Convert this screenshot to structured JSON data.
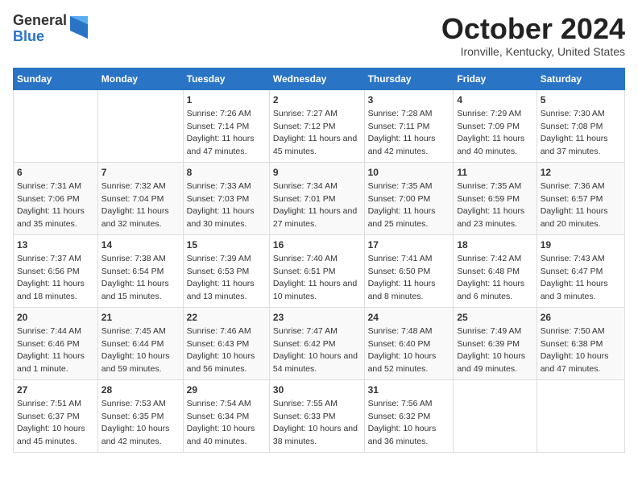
{
  "logo": {
    "general": "General",
    "blue": "Blue"
  },
  "header": {
    "month": "October 2024",
    "location": "Ironville, Kentucky, United States"
  },
  "weekdays": [
    "Sunday",
    "Monday",
    "Tuesday",
    "Wednesday",
    "Thursday",
    "Friday",
    "Saturday"
  ],
  "weeks": [
    [
      {
        "day": "",
        "info": ""
      },
      {
        "day": "",
        "info": ""
      },
      {
        "day": "1",
        "info": "Sunrise: 7:26 AM\nSunset: 7:14 PM\nDaylight: 11 hours and 47 minutes."
      },
      {
        "day": "2",
        "info": "Sunrise: 7:27 AM\nSunset: 7:12 PM\nDaylight: 11 hours and 45 minutes."
      },
      {
        "day": "3",
        "info": "Sunrise: 7:28 AM\nSunset: 7:11 PM\nDaylight: 11 hours and 42 minutes."
      },
      {
        "day": "4",
        "info": "Sunrise: 7:29 AM\nSunset: 7:09 PM\nDaylight: 11 hours and 40 minutes."
      },
      {
        "day": "5",
        "info": "Sunrise: 7:30 AM\nSunset: 7:08 PM\nDaylight: 11 hours and 37 minutes."
      }
    ],
    [
      {
        "day": "6",
        "info": "Sunrise: 7:31 AM\nSunset: 7:06 PM\nDaylight: 11 hours and 35 minutes."
      },
      {
        "day": "7",
        "info": "Sunrise: 7:32 AM\nSunset: 7:04 PM\nDaylight: 11 hours and 32 minutes."
      },
      {
        "day": "8",
        "info": "Sunrise: 7:33 AM\nSunset: 7:03 PM\nDaylight: 11 hours and 30 minutes."
      },
      {
        "day": "9",
        "info": "Sunrise: 7:34 AM\nSunset: 7:01 PM\nDaylight: 11 hours and 27 minutes."
      },
      {
        "day": "10",
        "info": "Sunrise: 7:35 AM\nSunset: 7:00 PM\nDaylight: 11 hours and 25 minutes."
      },
      {
        "day": "11",
        "info": "Sunrise: 7:35 AM\nSunset: 6:59 PM\nDaylight: 11 hours and 23 minutes."
      },
      {
        "day": "12",
        "info": "Sunrise: 7:36 AM\nSunset: 6:57 PM\nDaylight: 11 hours and 20 minutes."
      }
    ],
    [
      {
        "day": "13",
        "info": "Sunrise: 7:37 AM\nSunset: 6:56 PM\nDaylight: 11 hours and 18 minutes."
      },
      {
        "day": "14",
        "info": "Sunrise: 7:38 AM\nSunset: 6:54 PM\nDaylight: 11 hours and 15 minutes."
      },
      {
        "day": "15",
        "info": "Sunrise: 7:39 AM\nSunset: 6:53 PM\nDaylight: 11 hours and 13 minutes."
      },
      {
        "day": "16",
        "info": "Sunrise: 7:40 AM\nSunset: 6:51 PM\nDaylight: 11 hours and 10 minutes."
      },
      {
        "day": "17",
        "info": "Sunrise: 7:41 AM\nSunset: 6:50 PM\nDaylight: 11 hours and 8 minutes."
      },
      {
        "day": "18",
        "info": "Sunrise: 7:42 AM\nSunset: 6:48 PM\nDaylight: 11 hours and 6 minutes."
      },
      {
        "day": "19",
        "info": "Sunrise: 7:43 AM\nSunset: 6:47 PM\nDaylight: 11 hours and 3 minutes."
      }
    ],
    [
      {
        "day": "20",
        "info": "Sunrise: 7:44 AM\nSunset: 6:46 PM\nDaylight: 11 hours and 1 minute."
      },
      {
        "day": "21",
        "info": "Sunrise: 7:45 AM\nSunset: 6:44 PM\nDaylight: 10 hours and 59 minutes."
      },
      {
        "day": "22",
        "info": "Sunrise: 7:46 AM\nSunset: 6:43 PM\nDaylight: 10 hours and 56 minutes."
      },
      {
        "day": "23",
        "info": "Sunrise: 7:47 AM\nSunset: 6:42 PM\nDaylight: 10 hours and 54 minutes."
      },
      {
        "day": "24",
        "info": "Sunrise: 7:48 AM\nSunset: 6:40 PM\nDaylight: 10 hours and 52 minutes."
      },
      {
        "day": "25",
        "info": "Sunrise: 7:49 AM\nSunset: 6:39 PM\nDaylight: 10 hours and 49 minutes."
      },
      {
        "day": "26",
        "info": "Sunrise: 7:50 AM\nSunset: 6:38 PM\nDaylight: 10 hours and 47 minutes."
      }
    ],
    [
      {
        "day": "27",
        "info": "Sunrise: 7:51 AM\nSunset: 6:37 PM\nDaylight: 10 hours and 45 minutes."
      },
      {
        "day": "28",
        "info": "Sunrise: 7:53 AM\nSunset: 6:35 PM\nDaylight: 10 hours and 42 minutes."
      },
      {
        "day": "29",
        "info": "Sunrise: 7:54 AM\nSunset: 6:34 PM\nDaylight: 10 hours and 40 minutes."
      },
      {
        "day": "30",
        "info": "Sunrise: 7:55 AM\nSunset: 6:33 PM\nDaylight: 10 hours and 38 minutes."
      },
      {
        "day": "31",
        "info": "Sunrise: 7:56 AM\nSunset: 6:32 PM\nDaylight: 10 hours and 36 minutes."
      },
      {
        "day": "",
        "info": ""
      },
      {
        "day": "",
        "info": ""
      }
    ]
  ]
}
